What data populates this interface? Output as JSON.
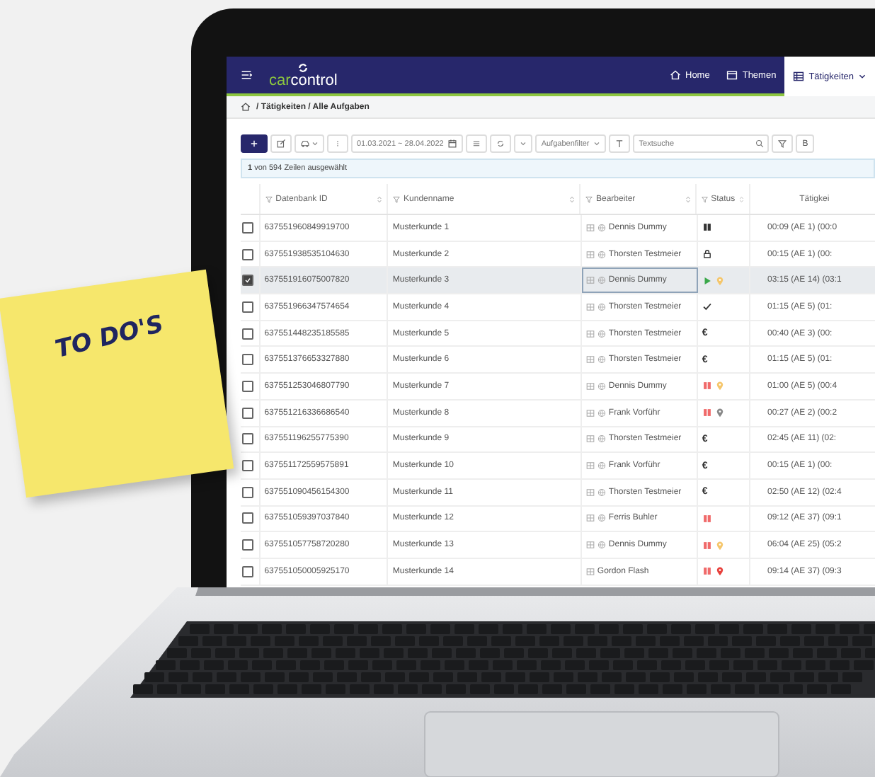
{
  "note": {
    "text": "TO DO'S"
  },
  "app": {
    "logo": [
      {
        "text": "car",
        "color": "#8cc63f"
      },
      {
        "text": "control",
        "color": "#ffffff"
      }
    ],
    "nav": [
      {
        "label": "Home",
        "kind": "house",
        "selected": false,
        "dropdown": false
      },
      {
        "label": "Themen",
        "kind": "window",
        "selected": false,
        "dropdown": false
      },
      {
        "label": "Tätigkeiten",
        "kind": "table",
        "selected": true,
        "dropdown": true
      }
    ],
    "breadcrumb": "/ Tätigkeiten / Alle Aufgaben",
    "toolbar": {
      "date_range": "01.03.2021 ~ 28.04.2022",
      "filter": "Aufgabenfilter",
      "search_placeholder": "Textsuche",
      "cut_button": "B"
    },
    "selection_info": "**1** von 594 Zeilen ausgewählt",
    "columns": [
      "Datenbank ID",
      "Kundenname",
      "Bearbeiter",
      "Status",
      "Tätigkei"
    ],
    "rows": [
      {
        "id": "637551960849919700",
        "customer": "Musterkunde 1",
        "assignee": "Dennis Dummy",
        "globe": true,
        "status": [
          {
            "kind": "pause",
            "color": "#333333"
          }
        ],
        "time": "00:09 (AE 1) (00:0",
        "selected": false
      },
      {
        "id": "637551938535104630",
        "customer": "Musterkunde 2",
        "assignee": "Thorsten Testmeier",
        "globe": true,
        "status": [
          {
            "kind": "lock",
            "color": "#333333"
          }
        ],
        "time": "00:15 (AE 1) (00:",
        "selected": false
      },
      {
        "id": "637551916075007820",
        "customer": "Musterkunde 3",
        "assignee": "Dennis Dummy",
        "globe": true,
        "status": [
          {
            "kind": "play",
            "color": "#3aa84a"
          },
          {
            "kind": "pin",
            "color": "#f5c66b"
          }
        ],
        "time": "03:15 (AE 14) (03:1",
        "selected": true
      },
      {
        "id": "637551966347574654",
        "customer": "Musterkunde 4",
        "assignee": "Thorsten Testmeier",
        "globe": true,
        "status": [
          {
            "kind": "check",
            "color": "#333333"
          }
        ],
        "time": "01:15 (AE 5) (01:",
        "selected": false
      },
      {
        "id": "637551448235185585",
        "customer": "Musterkunde 5",
        "assignee": "Thorsten Testmeier",
        "globe": true,
        "status": [
          {
            "kind": "symbol",
            "text": "€",
            "color": "#333333"
          }
        ],
        "time": "00:40 (AE 3) (00:",
        "selected": false
      },
      {
        "id": "637551376653327880",
        "customer": "Musterkunde 6",
        "assignee": "Thorsten Testmeier",
        "globe": true,
        "status": [
          {
            "kind": "symbol",
            "text": "€",
            "color": "#333333"
          }
        ],
        "time": "01:15 (AE 5) (01:",
        "selected": false
      },
      {
        "id": "637551253046807790",
        "customer": "Musterkunde 7",
        "assignee": "Dennis Dummy",
        "globe": true,
        "status": [
          {
            "kind": "pause",
            "color": "#f06a6a"
          },
          {
            "kind": "pin",
            "color": "#f5c66b"
          }
        ],
        "time": "01:00 (AE 5) (00:4",
        "selected": false
      },
      {
        "id": "637551216336686540",
        "customer": "Musterkunde 8",
        "assignee": "Frank Vorführ",
        "globe": true,
        "status": [
          {
            "kind": "pause",
            "color": "#f06a6a"
          },
          {
            "kind": "pin",
            "color": "#888888"
          }
        ],
        "time": "00:27 (AE 2) (00:2",
        "selected": false
      },
      {
        "id": "637551196255775390",
        "customer": "Musterkunde 9",
        "assignee": "Thorsten Testmeier",
        "globe": true,
        "status": [
          {
            "kind": "symbol",
            "text": "€",
            "color": "#333333"
          }
        ],
        "time": "02:45 (AE 11) (02:",
        "selected": false
      },
      {
        "id": "637551172559575891",
        "customer": "Musterkunde 10",
        "assignee": "Frank Vorführ",
        "globe": true,
        "status": [
          {
            "kind": "symbol",
            "text": "€",
            "color": "#333333"
          }
        ],
        "time": "00:15 (AE 1) (00:",
        "selected": false
      },
      {
        "id": "637551090456154300",
        "customer": "Musterkunde 11",
        "assignee": "Thorsten Testmeier",
        "globe": true,
        "status": [
          {
            "kind": "symbol",
            "text": "€",
            "color": "#333333"
          }
        ],
        "time": "02:50 (AE 12) (02:4",
        "selected": false
      },
      {
        "id": "637551059397037840",
        "customer": "Musterkunde 12",
        "assignee": "Ferris Buhler",
        "globe": true,
        "status": [
          {
            "kind": "pause",
            "color": "#f06a6a"
          }
        ],
        "time": "09:12 (AE 37) (09:1",
        "selected": false
      },
      {
        "id": "637551057758720280",
        "customer": "Musterkunde 13",
        "assignee": "Dennis Dummy",
        "globe": true,
        "status": [
          {
            "kind": "pause",
            "color": "#f06a6a"
          },
          {
            "kind": "pin",
            "color": "#f5c66b"
          }
        ],
        "time": "06:04 (AE 25) (05:2",
        "selected": false
      },
      {
        "id": "637551050005925170",
        "customer": "Musterkunde 14",
        "assignee": "Gordon Flash",
        "globe": false,
        "status": [
          {
            "kind": "pause",
            "color": "#f06a6a"
          },
          {
            "kind": "pin",
            "color": "#e8413c"
          }
        ],
        "time": "09:14 (AE 37) (09:3",
        "selected": false
      }
    ]
  }
}
